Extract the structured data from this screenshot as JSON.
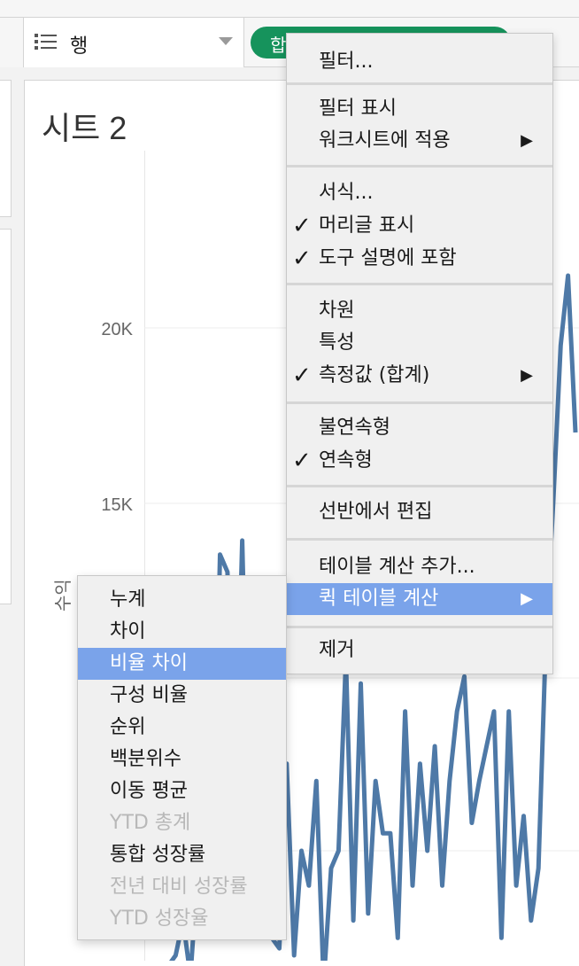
{
  "shelf": {
    "rows_label": "행",
    "pill_label": "합계(수익)"
  },
  "sheet": {
    "title": "시트 2",
    "y_axis_label": "수익",
    "ticks": [
      "20K",
      "15K"
    ]
  },
  "chart_data": {
    "type": "line",
    "yticks": [
      "20K",
      "15K"
    ],
    "ylabel": "수익",
    "series": [
      {
        "color": "#4e79a7",
        "values": [
          1700,
          2000,
          3000,
          1400,
          4500,
          12000,
          4000,
          13500,
          13000,
          6000,
          13900,
          5000,
          9000,
          4800,
          2500,
          2200,
          7500,
          2000,
          5000,
          4000,
          7000,
          1200,
          4500,
          5000,
          10500,
          3000,
          9800,
          3200,
          7000,
          5500,
          5500,
          2500,
          9000,
          4000,
          7500,
          5000,
          8000,
          4000,
          7000,
          9000,
          10000,
          5800,
          7000,
          8000,
          9000,
          2500,
          9000,
          4000,
          6000,
          3000,
          4500,
          11000,
          15000,
          19500,
          21500,
          17000
        ]
      }
    ]
  },
  "menu": {
    "items": [
      {
        "label": "필터...",
        "checked": false,
        "arrow": false
      },
      {
        "label": "필터 표시",
        "checked": false,
        "arrow": false
      },
      {
        "label": "워크시트에 적용",
        "checked": false,
        "arrow": true
      },
      {
        "label": "서식...",
        "checked": false,
        "arrow": false
      },
      {
        "label": "머리글 표시",
        "checked": true,
        "arrow": false
      },
      {
        "label": "도구 설명에 포함",
        "checked": true,
        "arrow": false
      },
      {
        "label": "차원",
        "checked": false,
        "arrow": false
      },
      {
        "label": "특성",
        "checked": false,
        "arrow": false
      },
      {
        "label": "측정값 (합계)",
        "checked": true,
        "arrow": true
      },
      {
        "label": "불연속형",
        "checked": false,
        "arrow": false
      },
      {
        "label": "연속형",
        "checked": true,
        "arrow": false
      },
      {
        "label": "선반에서 편집",
        "checked": false,
        "arrow": false
      },
      {
        "label": "테이블 계산 추가...",
        "checked": false,
        "arrow": false
      },
      {
        "label": "퀵 테이블 계산",
        "checked": false,
        "arrow": true,
        "highlighted": true
      },
      {
        "label": "제거",
        "checked": false,
        "arrow": false
      }
    ],
    "check_glyph": "✓",
    "arrow_glyph": "▶"
  },
  "submenu": {
    "items": [
      {
        "label": "누계",
        "enabled": true
      },
      {
        "label": "차이",
        "enabled": true
      },
      {
        "label": "비율 차이",
        "enabled": true,
        "highlighted": true
      },
      {
        "label": "구성 비율",
        "enabled": true
      },
      {
        "label": "순위",
        "enabled": true
      },
      {
        "label": "백분위수",
        "enabled": true
      },
      {
        "label": "이동 평균",
        "enabled": true
      },
      {
        "label": "YTD 총계",
        "enabled": false
      },
      {
        "label": "통합 성장률",
        "enabled": true
      },
      {
        "label": "전년 대비 성장률",
        "enabled": false
      },
      {
        "label": "YTD 성장율",
        "enabled": false
      }
    ]
  },
  "colors": {
    "pill": "#16935c",
    "line": "#4e79a7",
    "highlight": "#7aa3ea"
  }
}
